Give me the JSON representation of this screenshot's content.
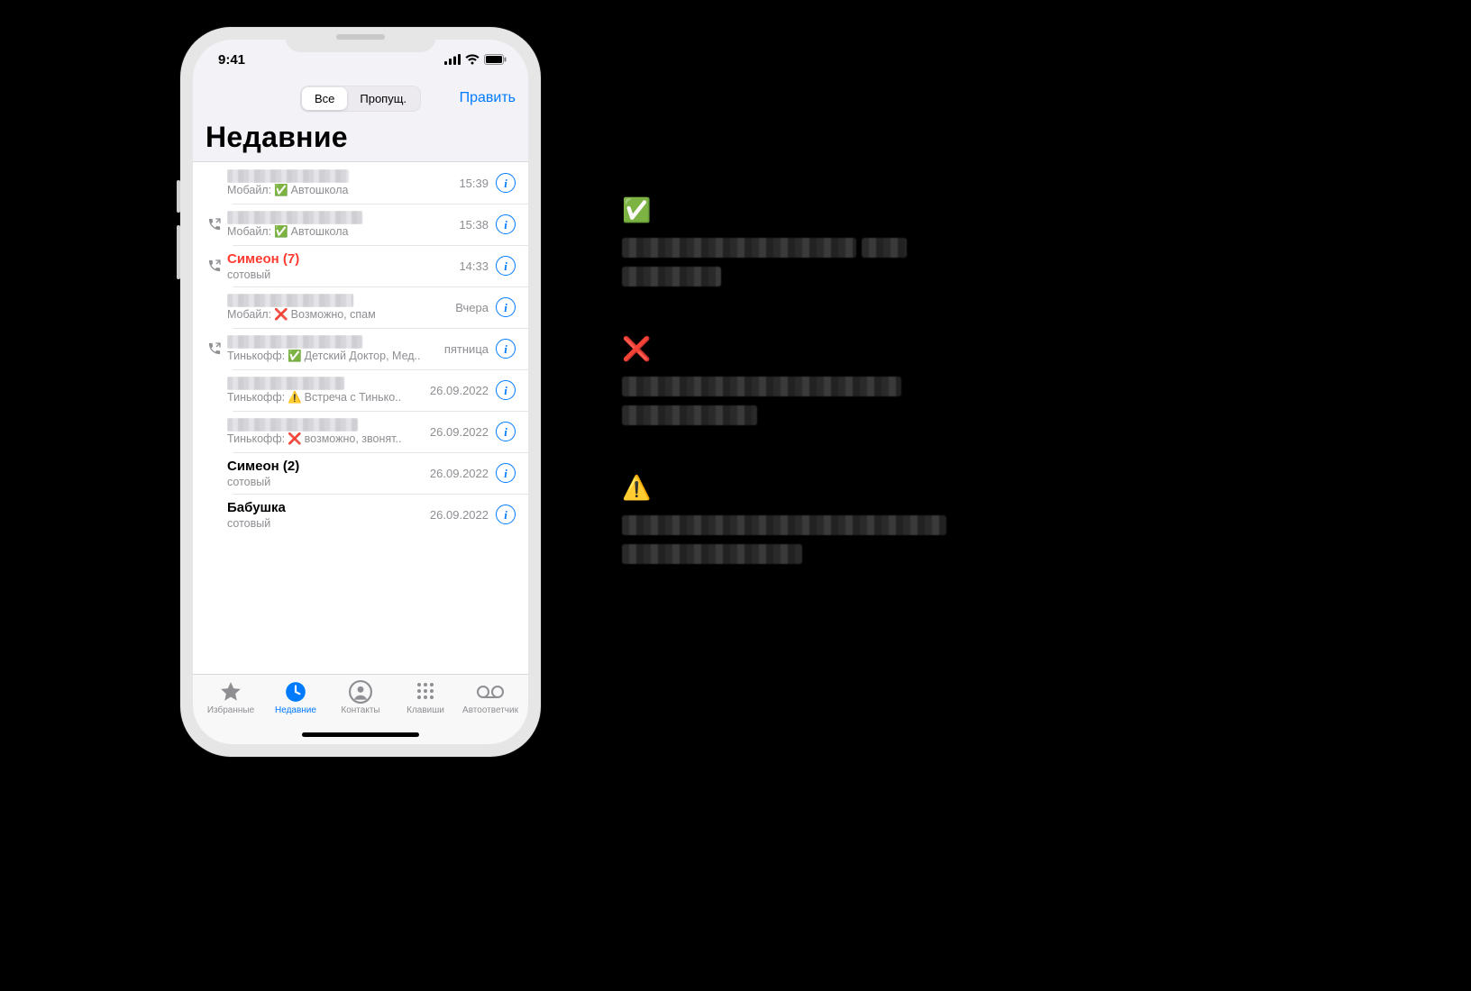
{
  "status": {
    "time": "9:41"
  },
  "nav": {
    "segment_all": "Все",
    "segment_missed": "Пропущ.",
    "edit": "Править",
    "title": "Недавние"
  },
  "calls": [
    {
      "name_blurred": true,
      "name_w": 135,
      "missed": false,
      "bold": false,
      "outgoing": false,
      "sub_prefix": "Мобайл:",
      "sub_mark": "✅",
      "sub_text": "Автошкола",
      "time": "15:39"
    },
    {
      "name_blurred": true,
      "name_w": 150,
      "missed": false,
      "bold": false,
      "outgoing": true,
      "sub_prefix": "Мобайл:",
      "sub_mark": "✅",
      "sub_text": "Автошкола",
      "time": "15:38"
    },
    {
      "name": "Симеон (7)",
      "missed": true,
      "bold": true,
      "outgoing": true,
      "sub_prefix": "",
      "sub_mark": "",
      "sub_text": "сотовый",
      "time": "14:33"
    },
    {
      "name_blurred": true,
      "name_w": 140,
      "missed": false,
      "bold": false,
      "outgoing": false,
      "sub_prefix": "Мобайл:",
      "sub_mark": "❌",
      "sub_text": "Возможно, спам",
      "time": "Вчера"
    },
    {
      "name_blurred": true,
      "name_w": 150,
      "missed": false,
      "bold": false,
      "outgoing": true,
      "sub_prefix": "Тинькофф:",
      "sub_mark": "✅",
      "sub_text": "Детский Доктор, Мед..",
      "time": "пятница"
    },
    {
      "name_blurred": true,
      "name_w": 130,
      "missed": false,
      "bold": false,
      "outgoing": false,
      "sub_prefix": "Тинькофф:",
      "sub_mark": "⚠️",
      "sub_text": "Встреча с Тинько..",
      "time": "26.09.2022"
    },
    {
      "name_blurred": true,
      "name_w": 145,
      "missed": false,
      "bold": false,
      "outgoing": false,
      "sub_prefix": "Тинькофф:",
      "sub_mark": "❌",
      "sub_text": "возможно, звонят..",
      "time": "26.09.2022"
    },
    {
      "name": "Симеон (2)",
      "missed": false,
      "bold": true,
      "outgoing": false,
      "sub_prefix": "",
      "sub_mark": "",
      "sub_text": "сотовый",
      "time": "26.09.2022"
    },
    {
      "name": "Бабушка",
      "missed": false,
      "bold": true,
      "outgoing": false,
      "sub_prefix": "",
      "sub_mark": "",
      "sub_text": "сотовый",
      "time": "26.09.2022"
    }
  ],
  "tabs": {
    "favorites": "Избранные",
    "recents": "Недавние",
    "contacts": "Контакты",
    "keypad": "Клавиши",
    "voicemail": "Автоответчик",
    "active_index": 1
  },
  "legend": {
    "items": [
      {
        "mark": "✅",
        "line1_widths": [
          260,
          50
        ],
        "line2_widths": [
          110
        ]
      },
      {
        "mark": "❌",
        "line1_widths": [
          310
        ],
        "line2_widths": [
          150
        ]
      },
      {
        "mark": "⚠️",
        "line1_widths": [
          360
        ],
        "line2_widths": [
          200
        ]
      }
    ]
  }
}
